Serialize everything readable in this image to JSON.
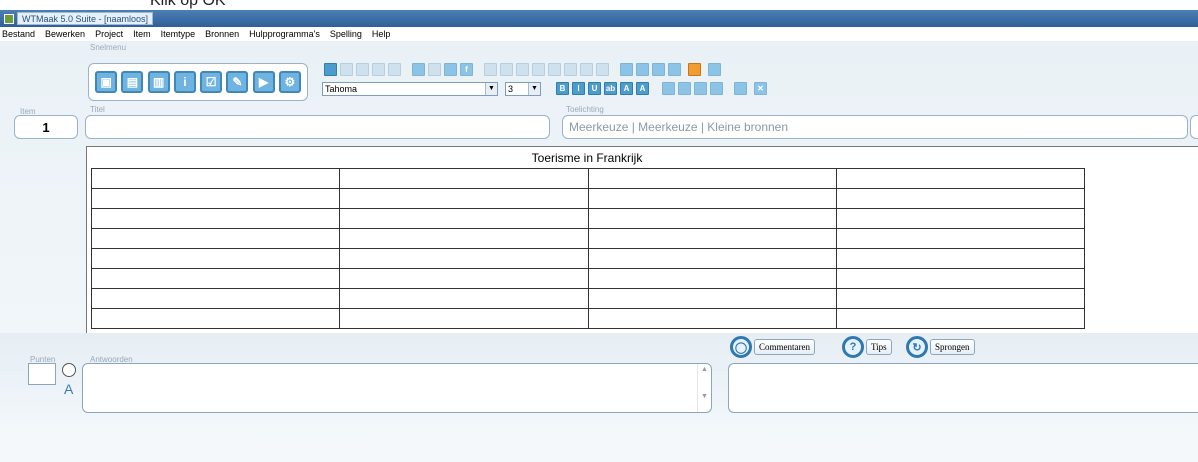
{
  "caption": "Klik op OK",
  "window": {
    "title": "WTMaak 5.0 Suite - [naamloos]"
  },
  "menu": [
    "Bestand",
    "Bewerken",
    "Project",
    "Item",
    "Itemtype",
    "Bronnen",
    "Hulpprogramma's",
    "Spelling",
    "Help"
  ],
  "labels": {
    "snelmenu": "Snelmenu",
    "item": "Item",
    "titel": "Titel",
    "toelichting": "Toelichting",
    "punten": "Punten",
    "antwoorden": "Antwoorden"
  },
  "toolbar": {
    "font_name": "Tahoma",
    "font_size": "3"
  },
  "fields": {
    "item_number": "1",
    "title_value": "",
    "toelichting_value": "Meerkeuze | Meerkeuze | Kleine bronnen"
  },
  "table": {
    "title": "Toerisme in Frankrijk",
    "rows": 8,
    "cols": 4
  },
  "answer": {
    "radio_letter": "A"
  },
  "buttons": {
    "commentaren": "Commentaren",
    "tips": "Tips",
    "sprongen": "Sprongen"
  },
  "colors": {
    "accent": "#2f78b0",
    "titlebar": "#3b6ea5"
  }
}
